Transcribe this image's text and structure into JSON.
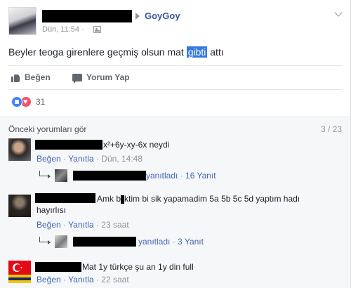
{
  "post": {
    "group_name": "GoyGoy",
    "time": "Dün, 11:54 ·",
    "text_before": "Beyler teoga girenlere geçmiş olsun mat ",
    "text_highlight": "gibti",
    "text_after": " attı",
    "actions": {
      "like": "Beğen",
      "comment": "Yorum Yap"
    },
    "reactions_count": "31"
  },
  "comments": {
    "previous_label": "Önceki yorumları gör",
    "page_count": "3 / 23",
    "items": [
      {
        "text": "x²+6y-xy-6x neydi",
        "like_label": "Beğen",
        "reply_label": "Yanıtla",
        "time": "Dün, 14:48",
        "replies_suffix": "yanıtladı",
        "replies_count": "16 Yanıt"
      },
      {
        "text": "Amk b",
        "text_after": "ktim bi sik yapamadim 5a 5b 5c 5d yaptım hadı",
        "text_line2": "hayırlısı",
        "like_label": "Beğen",
        "reply_label": "Yanıtla",
        "time": "23 saat",
        "replies_suffix": "yanıtladı",
        "replies_count": "3 Yanıt"
      },
      {
        "text": "Mat 1y türkçe şu an 1y din full",
        "like_label": "Beğen",
        "reply_label": "Yanıtla",
        "time": "22 saat"
      }
    ]
  },
  "colors": {
    "link": "#365899",
    "action_link": "#4267b2",
    "highlight": "#3578e5",
    "like_reaction": "#4080ff",
    "love_reaction": "#f25268"
  },
  "icons": [
    "profile-avatar",
    "arrow-right-icon",
    "audience-icon",
    "chevron-down-icon",
    "thumbs-up-icon",
    "comment-bubble-icon",
    "like-reaction-icon",
    "love-reaction-icon",
    "reply-arrow-icon",
    "turkish-flag-icon"
  ]
}
